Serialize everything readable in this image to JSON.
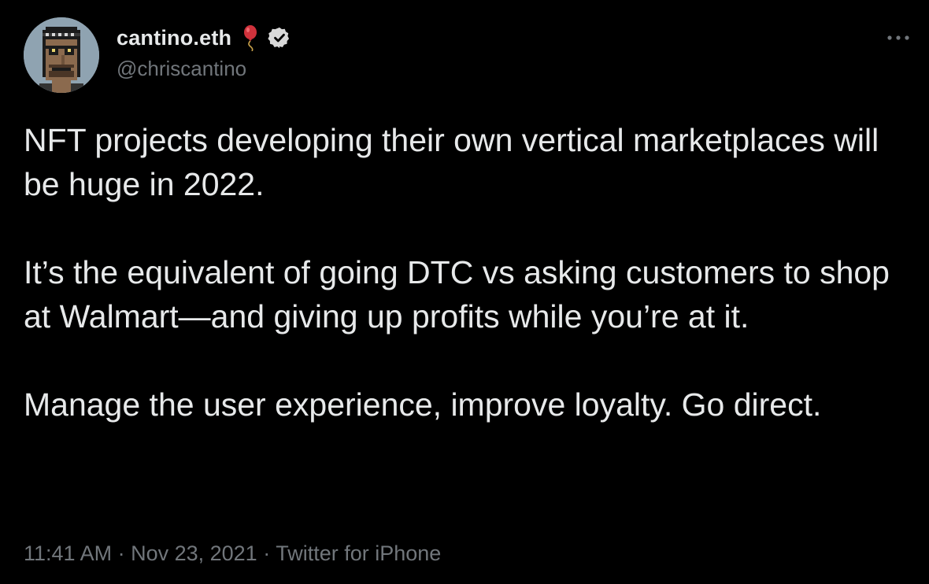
{
  "author": {
    "display_name": "cantino.eth",
    "handle": "@chriscantino",
    "badges": [
      "balloon-icon",
      "verified-icon"
    ]
  },
  "tweet": {
    "paragraphs": [
      "NFT projects developing their own vertical marketplaces will be huge in 2022.",
      "It’s the equivalent of going DTC vs asking customers to shop at Walmart—and giving up profits while you’re at it.",
      "Manage the user experience, improve loyalty. Go direct."
    ]
  },
  "meta": {
    "time": "11:41 AM",
    "separator": " · ",
    "date": "Nov 23, 2021",
    "source": "Twitter for iPhone"
  },
  "colors": {
    "background": "#000000",
    "text_primary": "#e7e9ea",
    "text_secondary": "#71767b"
  }
}
